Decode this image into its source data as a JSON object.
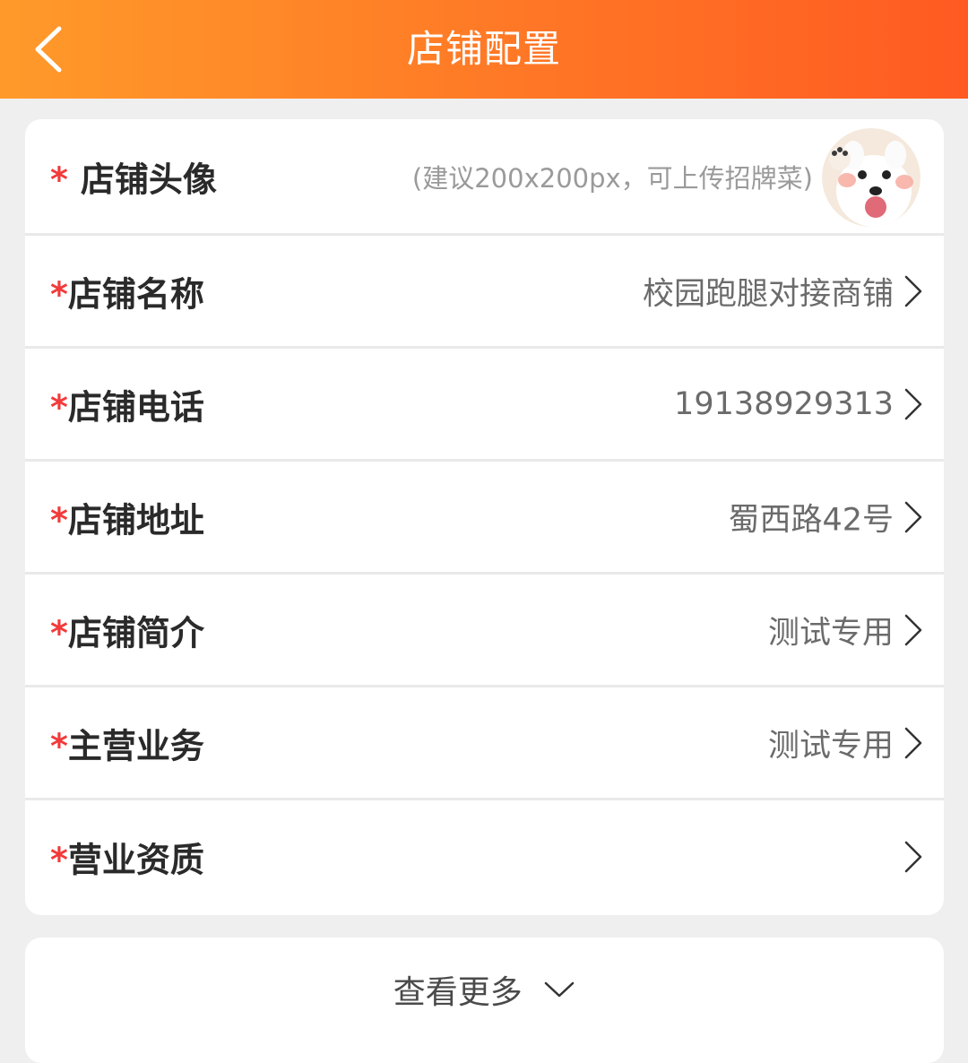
{
  "header": {
    "title": "店铺配置"
  },
  "form": {
    "avatar": {
      "required_mark": "*",
      "label": "店铺头像",
      "hint": "(建议200x200px，可上传招牌菜)",
      "image": "avatar-puppy"
    },
    "rows": [
      {
        "required_mark": "*",
        "label": "店铺名称",
        "value": "校园跑腿对接商铺"
      },
      {
        "required_mark": "*",
        "label": "店铺电话",
        "value": "19138929313"
      },
      {
        "required_mark": "*",
        "label": "店铺地址",
        "value": "蜀西路42号"
      },
      {
        "required_mark": "*",
        "label": "店铺简介",
        "value": "测试专用"
      },
      {
        "required_mark": "*",
        "label": "主营业务",
        "value": "测试专用"
      },
      {
        "required_mark": "*",
        "label": "营业资质",
        "value": ""
      }
    ]
  },
  "more": {
    "label": "查看更多"
  },
  "icons": {
    "back": "back-arrow-icon",
    "row_arrow": "chevron-right-icon",
    "more_arrow": "chevron-down-icon"
  },
  "colors": {
    "header_start": "#ff9a2a",
    "header_end": "#ff5a22",
    "required": "#f23a3a",
    "background": "#efefef"
  }
}
